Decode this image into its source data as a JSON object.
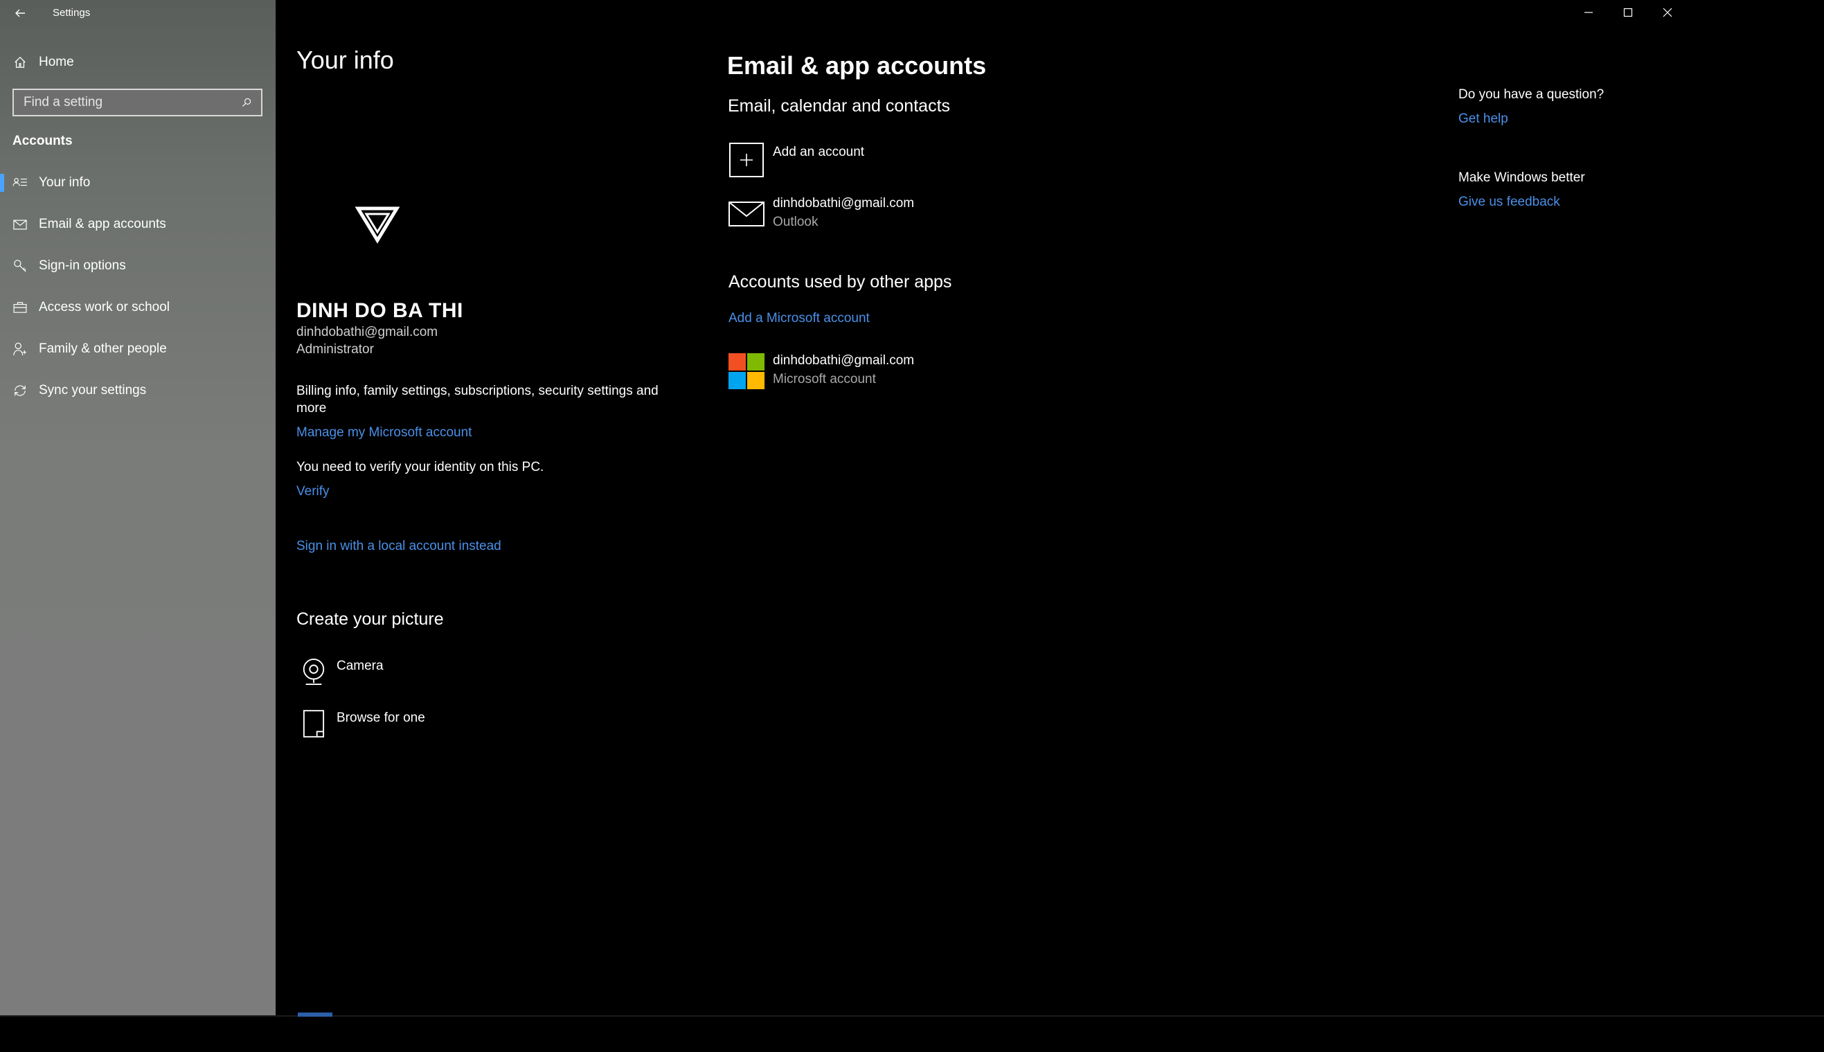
{
  "window": {
    "title": "Settings"
  },
  "sidebar": {
    "home_label": "Home",
    "search_placeholder": "Find a setting",
    "section_label": "Accounts",
    "items": [
      {
        "label": "Your info",
        "icon": "contact-card-icon",
        "active": true
      },
      {
        "label": "Email & app accounts",
        "icon": "mail-icon",
        "active": false
      },
      {
        "label": "Sign-in options",
        "icon": "key-icon",
        "active": false
      },
      {
        "label": "Access work or school",
        "icon": "briefcase-icon",
        "active": false
      },
      {
        "label": "Family & other people",
        "icon": "person-add-icon",
        "active": false
      },
      {
        "label": "Sync your settings",
        "icon": "sync-icon",
        "active": false
      }
    ]
  },
  "your_info": {
    "title": "Your info",
    "user_name": "DINH DO BA THI",
    "email": "dinhdobathi@gmail.com",
    "role": "Administrator",
    "billing_text": "Billing info, family settings, subscriptions, security settings and more",
    "manage_link": "Manage my Microsoft account",
    "verify_message": "You need to verify your identity on this PC.",
    "verify_link": "Verify",
    "local_account_link": "Sign in with a local account instead",
    "create_picture_title": "Create your picture",
    "picture_options": [
      {
        "label": "Camera",
        "icon": "camera-icon"
      },
      {
        "label": "Browse for one",
        "icon": "file-icon"
      }
    ]
  },
  "email_accounts": {
    "title": "Email & app accounts",
    "subtitle": "Email, calendar and contacts",
    "add_account_label": "Add an account",
    "email_account": {
      "address": "dinhdobathi@gmail.com",
      "provider": "Outlook"
    },
    "other_apps_title": "Accounts used by other apps",
    "add_ms_link": "Add a Microsoft account",
    "ms_account": {
      "address": "dinhdobathi@gmail.com",
      "type": "Microsoft account"
    }
  },
  "help": {
    "question_title": "Do you have a question?",
    "get_help_link": "Get help",
    "improve_title": "Make Windows better",
    "feedback_link": "Give us feedback"
  },
  "colors": {
    "accent": "#4aa3ff",
    "link": "#4a90e8",
    "ms_red": "#f25022",
    "ms_green": "#7fba00",
    "ms_blue": "#00a4ef",
    "ms_yellow": "#ffb900"
  }
}
